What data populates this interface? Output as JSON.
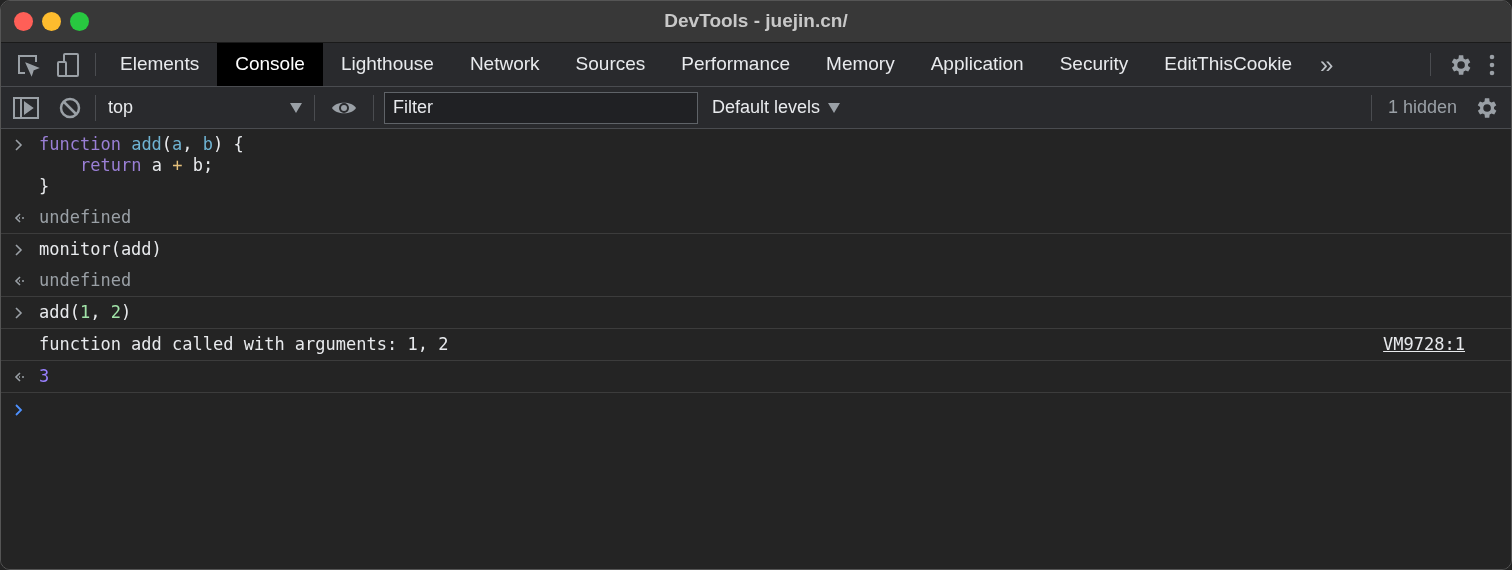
{
  "window": {
    "title": "DevTools - juejin.cn/"
  },
  "tabs": [
    {
      "label": "Elements",
      "selected": false
    },
    {
      "label": "Console",
      "selected": true
    },
    {
      "label": "Lighthouse",
      "selected": false
    },
    {
      "label": "Network",
      "selected": false
    },
    {
      "label": "Sources",
      "selected": false
    },
    {
      "label": "Performance",
      "selected": false
    },
    {
      "label": "Memory",
      "selected": false
    },
    {
      "label": "Application",
      "selected": false
    },
    {
      "label": "Security",
      "selected": false
    },
    {
      "label": "EditThisCookie",
      "selected": false
    }
  ],
  "more_tabs": "»",
  "console_toolbar": {
    "context": "top",
    "filter": {
      "placeholder": "Filter"
    },
    "levels": "Default levels",
    "hidden_count": "1 hidden"
  },
  "console": [
    {
      "kind": "input",
      "lines": [
        {
          "tokens": [
            {
              "text": "function",
              "kind": "keyword"
            },
            {
              "text": "add",
              "kind": "name"
            },
            {
              "text": "(",
              "kind": "plain"
            },
            {
              "text": "a",
              "kind": "name"
            },
            {
              "text": ",",
              "kind": "plain"
            },
            {
              "text": "b",
              "kind": "name"
            },
            {
              "text": ") {",
              "kind": "plain"
            }
          ]
        },
        {
          "indent": true,
          "tokens": [
            {
              "text": "return",
              "kind": "keyword"
            },
            {
              "text": "a",
              "kind": "plain"
            },
            {
              "text": "+",
              "kind": "operator"
            },
            {
              "text": "b;",
              "kind": "plain"
            }
          ]
        },
        {
          "tokens": [
            {
              "text": "}",
              "kind": "plain"
            }
          ]
        }
      ]
    },
    {
      "kind": "result",
      "lines": [
        {
          "tokens": [
            {
              "text": "undefined",
              "kind": "undefined"
            }
          ]
        }
      ]
    },
    {
      "kind": "input",
      "lines": [
        {
          "tokens": [
            {
              "text": "monitor(add)",
              "kind": "plain"
            }
          ]
        }
      ]
    },
    {
      "kind": "result",
      "lines": [
        {
          "tokens": [
            {
              "text": "undefined",
              "kind": "undefined"
            }
          ]
        }
      ]
    },
    {
      "kind": "input",
      "lines": [
        {
          "tokens": [
            {
              "text": "add(",
              "kind": "plain"
            },
            {
              "text": "1",
              "kind": "number"
            },
            {
              "text": ",",
              "kind": "plain"
            },
            {
              "text": "2",
              "kind": "number"
            },
            {
              "text": ")",
              "kind": "plain"
            }
          ]
        }
      ]
    },
    {
      "kind": "log",
      "lines": [
        {
          "tokens": [
            {
              "text": "function add called with arguments: 1, 2",
              "kind": "plain"
            }
          ]
        }
      ],
      "source": "VM9728:1"
    },
    {
      "kind": "result",
      "lines": [
        {
          "tokens": [
            {
              "text": "3",
              "kind": "result_number"
            }
          ]
        }
      ]
    },
    {
      "kind": "prompt"
    }
  ]
}
